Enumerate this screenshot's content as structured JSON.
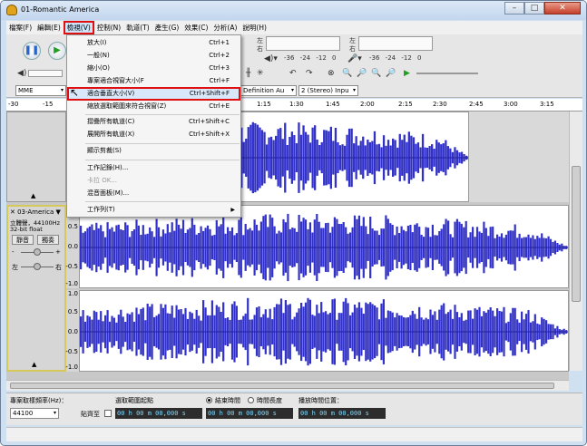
{
  "window": {
    "title": "01-Romantic America"
  },
  "menubar": [
    "檔案(F)",
    "編輯(E)",
    "檢視(V)",
    "控制(N)",
    "軌道(T)",
    "產生(G)",
    "效果(C)",
    "分析(A)",
    "說明(H)"
  ],
  "toolbar": {
    "pause": "❚❚",
    "play": "▶",
    "meter_left_label": "左",
    "meter_right_label": "右",
    "meter_scale": [
      "-36",
      "-24",
      "-12",
      "0"
    ],
    "host": "MME",
    "output_device": "Definition Au",
    "channels": "2 (Stereo) Inpu"
  },
  "ruler": [
    "-30",
    "-15",
    "1:15",
    "1:30",
    "1:45",
    "2:00",
    "2:15",
    "2:30",
    "2:45",
    "3:00",
    "3:15"
  ],
  "view_menu": {
    "items": [
      {
        "label": "放大(I)",
        "shortcut": "Ctrl+1"
      },
      {
        "label": "一般(N)",
        "shortcut": "Ctrl+2"
      },
      {
        "label": "縮小(O)",
        "shortcut": "Ctrl+3"
      },
      {
        "label": "專案適合視窗大小(F",
        "shortcut": "Ctrl+F"
      },
      {
        "label": "適合垂直大小(V)",
        "shortcut": "Ctrl+Shift+F"
      },
      {
        "label": "縮放選取範圍來符合視窗(Z)",
        "shortcut": "Ctrl+E"
      },
      {
        "label": "摺疊所有軌道(C)",
        "shortcut": "Ctrl+Shift+C"
      },
      {
        "label": "展開所有軌道(X)",
        "shortcut": "Ctrl+Shift+X"
      },
      {
        "label": "顯示剪裁(S)",
        "shortcut": ""
      },
      {
        "label": "工作記錄(H)...",
        "shortcut": ""
      },
      {
        "label": "卡拉 OK...",
        "shortcut": ""
      },
      {
        "label": "混音面板(M)...",
        "shortcut": ""
      },
      {
        "label": "工作列(T)",
        "shortcut": ""
      }
    ]
  },
  "track": {
    "name": "03-America",
    "info": "立體聲，44100Hz",
    "format": "32-bit float",
    "mute": "靜音",
    "solo": "獨奏",
    "gain_minus": "-",
    "gain_plus": "+",
    "pan_left": "左",
    "pan_right": "右",
    "scale": [
      "1.0",
      "0.5",
      "0.0",
      "-0.5",
      "-1.0"
    ]
  },
  "bottom": {
    "rate_label": "專案取樣頻率(Hz)：",
    "rate_value": "44100",
    "selection_label": "選取範圍起點",
    "snap_label": "貼齊至",
    "end_label": "結束時間",
    "length_label": "時間長度",
    "position_label": "播放時間位置：",
    "time_start": "00 h 00 m 00,000 s",
    "time_end": "00 h 00 m 00,000 s",
    "time_pos": "00 h 00 m 00,000 s"
  },
  "colors": {
    "wave": "#3232c8",
    "highlight": "#e01010"
  }
}
